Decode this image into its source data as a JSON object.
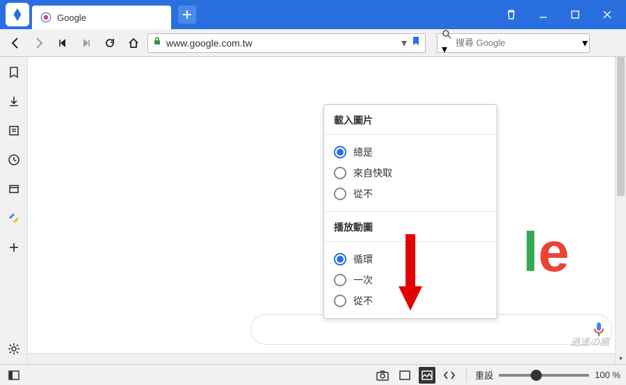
{
  "title_bar": {
    "tab_title": "Google",
    "new_tab_tooltip": "New Tab"
  },
  "address_bar": {
    "url": "www.google.com.tw",
    "search_placeholder": "搜尋 Google"
  },
  "sidebar": {
    "items": [
      "bookmarks",
      "downloads",
      "reader",
      "history",
      "window",
      "adsense",
      "add"
    ]
  },
  "popup": {
    "section1_title": "載入圖片",
    "section1_options": [
      {
        "label": "總是",
        "checked": true
      },
      {
        "label": "來自快取",
        "checked": false
      },
      {
        "label": "從不",
        "checked": false
      }
    ],
    "section2_title": "播放動圖",
    "section2_options": [
      {
        "label": "循環",
        "checked": true
      },
      {
        "label": "一次",
        "checked": false
      },
      {
        "label": "從不",
        "checked": false
      }
    ]
  },
  "status_bar": {
    "reset_label": "重設",
    "zoom_label": "100 %"
  },
  "watermark": {
    "line1": "逍遙の窩",
    "line2": "http://www.xiaoyao.tw"
  }
}
